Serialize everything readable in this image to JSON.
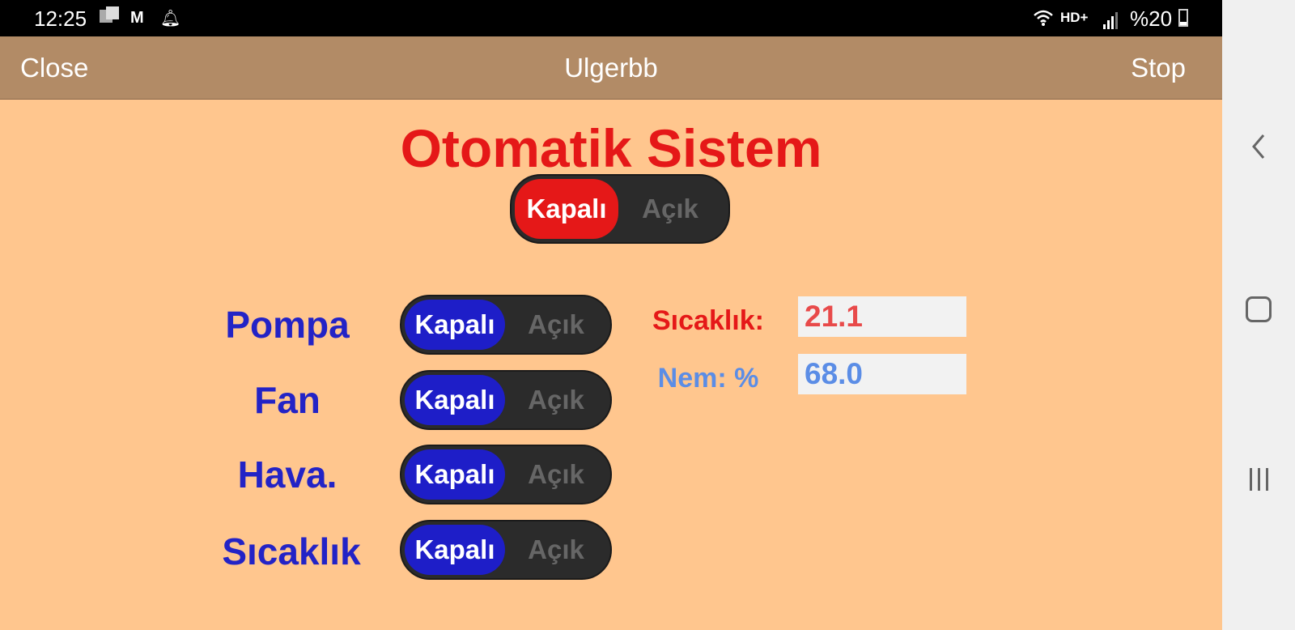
{
  "status_bar": {
    "time": "12:25",
    "hd_label": "HD+",
    "battery_text": "%20",
    "icons": [
      "gallery-icon",
      "gmail-icon",
      "bell-icon",
      "wifi-icon",
      "signal-icon",
      "battery-icon"
    ]
  },
  "app_bar": {
    "close_label": "Close",
    "title": "Ulgerbb",
    "stop_label": "Stop"
  },
  "main": {
    "title": "Otomatik Sistem",
    "master_toggle": {
      "off_label": "Kapalı",
      "on_label": "Açık",
      "state": "Kapalı",
      "color": "#e51818"
    },
    "devices": [
      {
        "label": "Pompa",
        "off_label": "Kapalı",
        "on_label": "Açık",
        "state": "Kapalı"
      },
      {
        "label": "Fan",
        "off_label": "Kapalı",
        "on_label": "Açık",
        "state": "Kapalı"
      },
      {
        "label": "Hava.",
        "off_label": "Kapalı",
        "on_label": "Açık",
        "state": "Kapalı"
      },
      {
        "label": "Sıcaklık",
        "off_label": "Kapalı",
        "on_label": "Açık",
        "state": "Kapalı"
      }
    ],
    "sensors": [
      {
        "label": "Sıcaklık:",
        "value": "21.1",
        "color": "#e84a4a"
      },
      {
        "label": "Nem: %",
        "value": "68.0",
        "color": "#5b8de6"
      }
    ]
  },
  "colors": {
    "app_bar": "#b28b66",
    "background": "#ffc68e",
    "device_label": "#2323c6",
    "device_knob": "#1e1ec8"
  },
  "nav_bar": {
    "icons": [
      "back-icon",
      "home-icon",
      "recent-apps-icon"
    ]
  }
}
